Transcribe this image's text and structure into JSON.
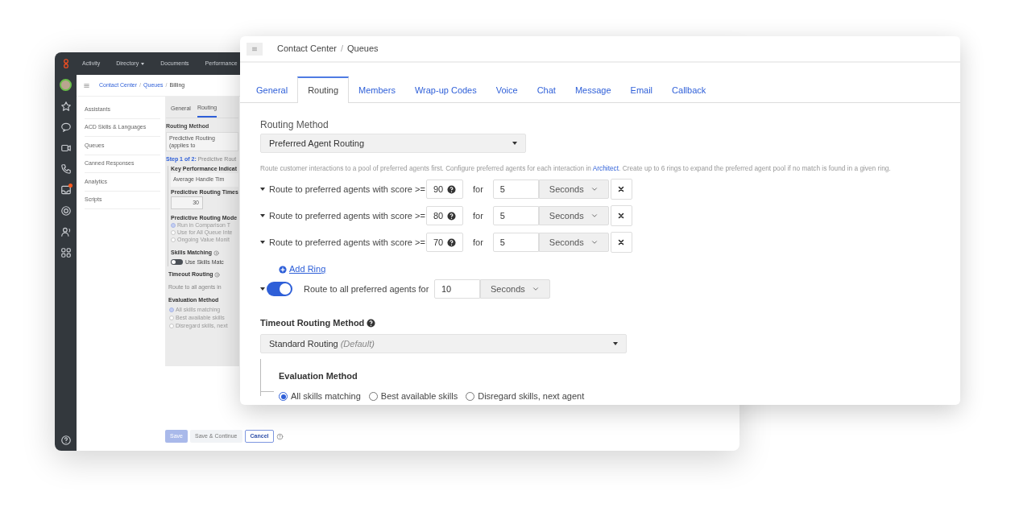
{
  "back_window": {
    "nav": [
      {
        "label": "Activity",
        "has_menu": false
      },
      {
        "label": "Directory",
        "has_menu": true
      },
      {
        "label": "Documents",
        "has_menu": false
      },
      {
        "label": "Performance",
        "has_menu": false
      }
    ],
    "breadcrumb": [
      "Contact Center",
      "Queues",
      "Billing"
    ],
    "breadcrumb_separator": "/",
    "side_menu": [
      "Assistants",
      "ACD Skills & Languages",
      "Queues",
      "Canned Responses",
      "Analytics",
      "Scripts"
    ],
    "tabs": [
      {
        "label": "General",
        "selected": false
      },
      {
        "label": "Routing",
        "selected": true
      }
    ],
    "routing_method": {
      "label": "Routing Method",
      "value": "Predictive Routing (applies to"
    },
    "step": {
      "number": "Step 1 of 2:",
      "text": "Predictive Rout"
    },
    "kpi": {
      "label": "Key Performance Indicat",
      "value": "Average Handle Tim"
    },
    "timeout": {
      "label": "Predictive Routing Times",
      "value": "30"
    },
    "mode": {
      "label": "Predictive Routing Mode",
      "options": [
        {
          "label": "Run in Comparison T",
          "selected": true
        },
        {
          "label": "Use for All Queue Inte",
          "selected": false
        },
        {
          "label": "Ongoing Value Monit",
          "selected": false
        }
      ]
    },
    "skills": {
      "label": "Skills Matching",
      "toggle_label": "Use Skills Matc",
      "on": false
    },
    "timeout_routing": {
      "label": "Timeout Routing",
      "text": "Route to all agents in"
    },
    "evaluation": {
      "label": "Evaluation Method",
      "options": [
        {
          "label": "All skills matching",
          "selected": true
        },
        {
          "label": "Best available skills",
          "selected": false
        },
        {
          "label": "Disregard skills, next",
          "selected": false
        }
      ]
    },
    "buttons": [
      {
        "label": "Save",
        "kind": "primary"
      },
      {
        "label": "Save & Continue",
        "kind": "secondary"
      },
      {
        "label": "Cancel",
        "kind": "outline"
      }
    ],
    "inbox_badge": true
  },
  "front_window": {
    "breadcrumb": [
      "Contact Center",
      "Queues"
    ],
    "breadcrumb_separator": "/",
    "tabs": [
      {
        "label": "General",
        "selected": false
      },
      {
        "label": "Routing",
        "selected": true
      },
      {
        "label": "Members",
        "selected": false
      },
      {
        "label": "Wrap-up Codes",
        "selected": false
      },
      {
        "label": "Voice",
        "selected": false
      },
      {
        "label": "Chat",
        "selected": false
      },
      {
        "label": "Message",
        "selected": false
      },
      {
        "label": "Email",
        "selected": false
      },
      {
        "label": "Callback",
        "selected": false
      }
    ],
    "routing_method": {
      "label": "Routing Method",
      "value": "Preferred Agent Routing"
    },
    "description": {
      "before": "Route customer interactions to a pool of preferred agents first. Configure preferred agents for each interaction in ",
      "link": "Architect",
      "after": ". Create up to 6 rings to expand the preferred agent pool if no match is found in a given ring."
    },
    "rings": [
      {
        "label": "Route to preferred agents with score >=",
        "score": "90",
        "for": "for",
        "duration": "5",
        "unit": "Seconds"
      },
      {
        "label": "Route to preferred agents with score >=",
        "score": "80",
        "for": "for",
        "duration": "5",
        "unit": "Seconds"
      },
      {
        "label": "Route to preferred agents with score >=",
        "score": "70",
        "for": "for",
        "duration": "5",
        "unit": "Seconds"
      }
    ],
    "add_ring": "Add Ring",
    "all_agents": {
      "on": true,
      "label": "Route to all preferred agents for",
      "duration": "10",
      "unit": "Seconds"
    },
    "timeout_method": {
      "label": "Timeout Routing Method",
      "value": "Standard Routing",
      "note": "(Default)"
    },
    "evaluation": {
      "label": "Evaluation Method",
      "options": [
        {
          "label": "All skills matching",
          "selected": true
        },
        {
          "label": "Best available skills",
          "selected": false
        },
        {
          "label": "Disregard skills, next agent",
          "selected": false
        }
      ]
    }
  }
}
